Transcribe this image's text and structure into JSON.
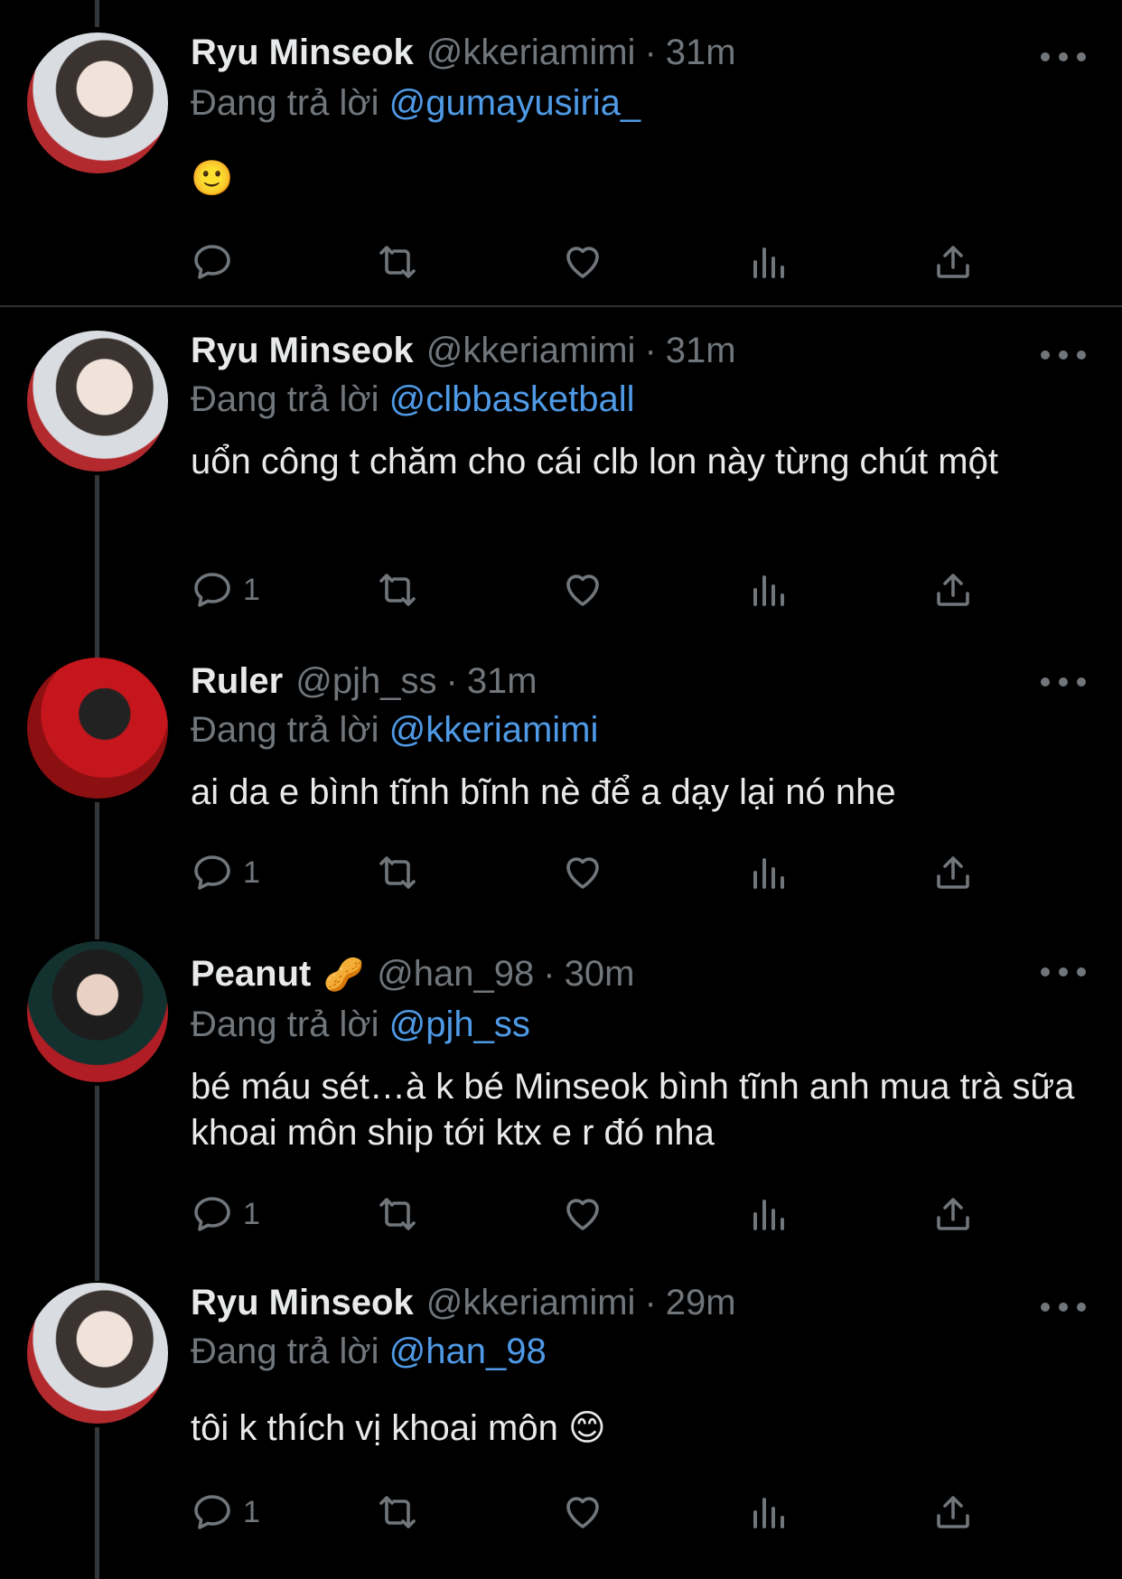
{
  "reply_prefix": "Đang trả lời",
  "tweets": [
    {
      "name": "Ryu Minseok",
      "handle": "@kkeriamimi",
      "separator": "·",
      "time": "31m",
      "reply_to": "@gumayusiria_",
      "text": "🙂",
      "reply_count": ""
    },
    {
      "name": "Ryu Minseok",
      "handle": "@kkeriamimi",
      "separator": "·",
      "time": "31m",
      "reply_to": "@clbbasketball",
      "text": "uổn công t chăm cho cái clb lon này từng chút một",
      "reply_count": "1"
    },
    {
      "name": "Ruler",
      "handle": "@pjh_ss",
      "separator": "·",
      "time": "31m",
      "reply_to": "@kkeriamimi",
      "text": "ai da e bình tĩnh bĩnh nè để a dạy lại nó nhe",
      "reply_count": "1"
    },
    {
      "name": "Peanut",
      "name_emoji": "🥜",
      "handle": "@han_98",
      "separator": "·",
      "time": "30m",
      "reply_to": "@pjh_ss",
      "text": "bé máu sét…à k bé Minseok bình tĩnh anh mua trà sữa khoai môn ship tới ktx e r đó nha",
      "reply_count": "1"
    },
    {
      "name": "Ryu Minseok",
      "handle": "@kkeriamimi",
      "separator": "·",
      "time": "29m",
      "reply_to": "@han_98",
      "text": "tôi k thích vị khoai môn 😊",
      "reply_count": "1"
    }
  ]
}
